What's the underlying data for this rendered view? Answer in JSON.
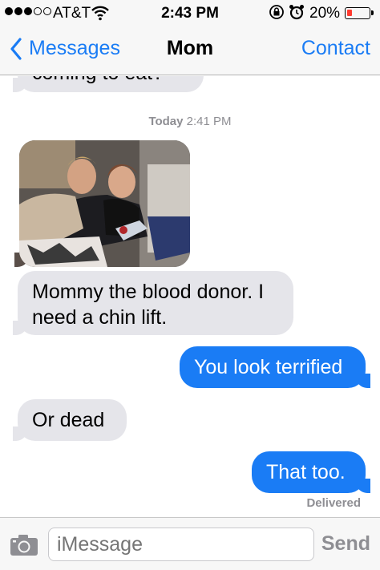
{
  "status_bar": {
    "carrier": "AT&T",
    "time": "2:43 PM",
    "battery": "20%",
    "battery_level": 0.2,
    "icons": [
      "signal-dots-icon",
      "wifi-icon",
      "rotation-lock-icon",
      "alarm-icon",
      "battery-icon"
    ]
  },
  "nav": {
    "back_label": "Messages",
    "title": "Mom",
    "contact_label": "Contact"
  },
  "conversation": {
    "partial_top_text": "coming to eat?",
    "timestamp_day": "Today",
    "timestamp_time": "2:41 PM",
    "messages": [
      {
        "sender": "Mom",
        "type": "photo"
      },
      {
        "sender": "Mom",
        "text": "Mommy the blood donor. I need a chin lift."
      },
      {
        "sender": "me",
        "text": "You look terrified"
      },
      {
        "sender": "Mom",
        "text": "Or dead"
      },
      {
        "sender": "me",
        "text": "That too."
      }
    ],
    "delivered": "Delivered"
  },
  "input_bar": {
    "placeholder": "iMessage",
    "send_label": "Send"
  },
  "colors": {
    "accent": "#1a7cf5",
    "incoming_bubble": "#e5e5ea",
    "outgoing_bubble": "#1a7cf5"
  }
}
